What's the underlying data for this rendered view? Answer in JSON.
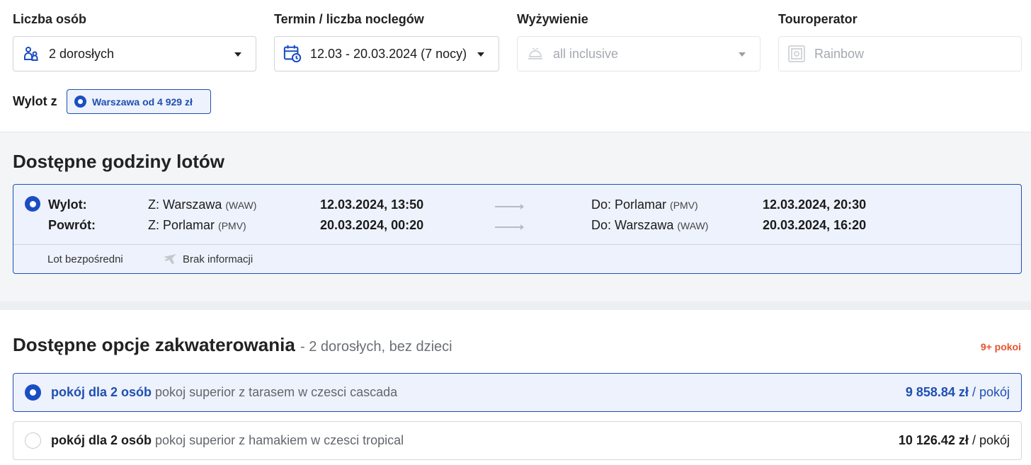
{
  "filters": {
    "persons": {
      "label": "Liczba osób",
      "value": "2 dorosłych",
      "icon": "persons-icon"
    },
    "term": {
      "label": "Termin / liczba noclegów",
      "value": "12.03 - 20.03.2024 (7 nocy)",
      "icon": "calendar-clock-icon"
    },
    "board": {
      "label": "Wyżywienie",
      "value": "all inclusive",
      "icon": "food-icon"
    },
    "operator": {
      "label": "Touroperator",
      "value": "Rainbow",
      "icon": "safe-icon"
    },
    "departure": {
      "label": "Wylot z",
      "chip": "Warszawa od 4 929 zł"
    }
  },
  "flights": {
    "title": "Dostępne godziny lotów",
    "rows": [
      {
        "label": "Wylot:",
        "from": "Z: Warszawa",
        "from_code": "(WAW)",
        "dep": "12.03.2024, 13:50",
        "to": "Do: Porlamar",
        "to_code": "(PMV)",
        "arr": "12.03.2024, 20:30"
      },
      {
        "label": "Powrót:",
        "from": "Z: Porlamar",
        "from_code": "(PMV)",
        "dep": "20.03.2024, 00:20",
        "to": "Do: Warszawa",
        "to_code": "(WAW)",
        "arr": "20.03.2024, 16:20"
      }
    ],
    "info_direct": "Lot bezpośredni",
    "info_plane": "Brak informacji"
  },
  "rooms": {
    "title": "Dostępne opcje zakwaterowania",
    "subtitle": "- 2 dorosłych, bez dzieci",
    "badge": "9+ pokoi",
    "items": [
      {
        "name": "pokój dla 2 osób",
        "desc": "pokoj superior z tarasem w czesci cascada",
        "price": "9 858.84 zł",
        "unit": "/ pokój",
        "selected": true
      },
      {
        "name": "pokój dla 2 osób",
        "desc": "pokoj superior z hamakiem w czesci tropical",
        "price": "10 126.42 zł",
        "unit": "/ pokój",
        "selected": false
      }
    ]
  },
  "colors": {
    "accent": "#1a4ec2",
    "badge": "#e6522c",
    "selected_bg": "#edf2fc"
  }
}
